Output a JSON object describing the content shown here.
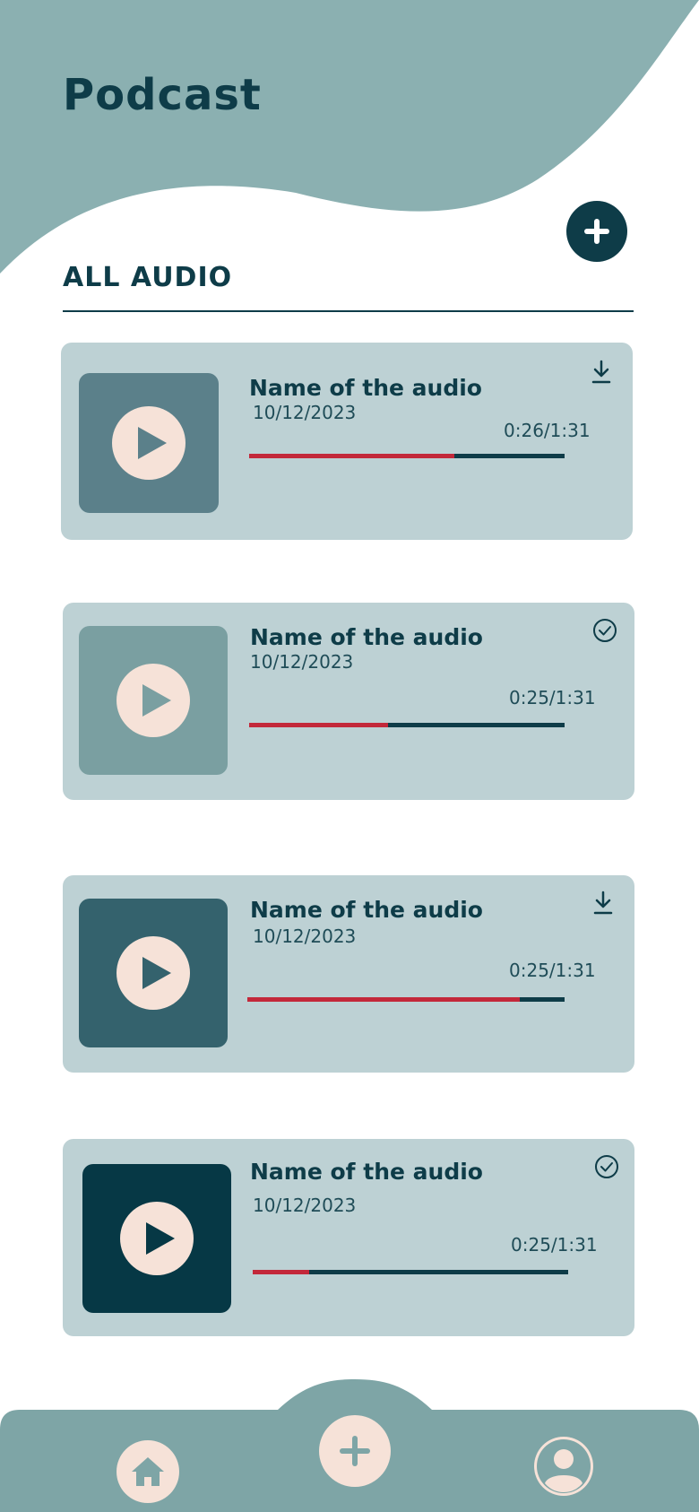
{
  "header": {
    "title": "Podcast"
  },
  "section": {
    "title": "ALL AUDIO"
  },
  "actions": {
    "add_icon": "plus-icon"
  },
  "colors": {
    "header_bg": "#8bb0b1",
    "accent_dark": "#0e3c48",
    "card_bg": "#bdd1d4",
    "progress_played": "#c3283a",
    "play_button_bg": "#f6e2d8",
    "nav_bg": "#7ea5a6"
  },
  "audios": [
    {
      "name": "Name of the audio",
      "date": "10/12/2023",
      "time": "0:26/1:31",
      "progress": 0.65,
      "status_icon": "download-icon",
      "thumb_color": "#5b808a"
    },
    {
      "name": "Name of the audio",
      "date": "10/12/2023",
      "time": "0:25/1:31",
      "progress": 0.44,
      "status_icon": "check-circle-icon",
      "thumb_color": "#7a9fa1"
    },
    {
      "name": "Name of the audio",
      "date": "10/12/2023",
      "time": "0:25/1:31",
      "progress": 0.86,
      "status_icon": "download-icon",
      "thumb_color": "#34626d"
    },
    {
      "name": "Name of the audio",
      "date": "10/12/2023",
      "time": "0:25/1:31",
      "progress": 0.18,
      "status_icon": "check-circle-icon",
      "thumb_color": "#063845"
    }
  ],
  "nav": [
    {
      "icon": "home-icon"
    },
    {
      "icon": "plus-icon"
    },
    {
      "icon": "user-icon"
    }
  ]
}
